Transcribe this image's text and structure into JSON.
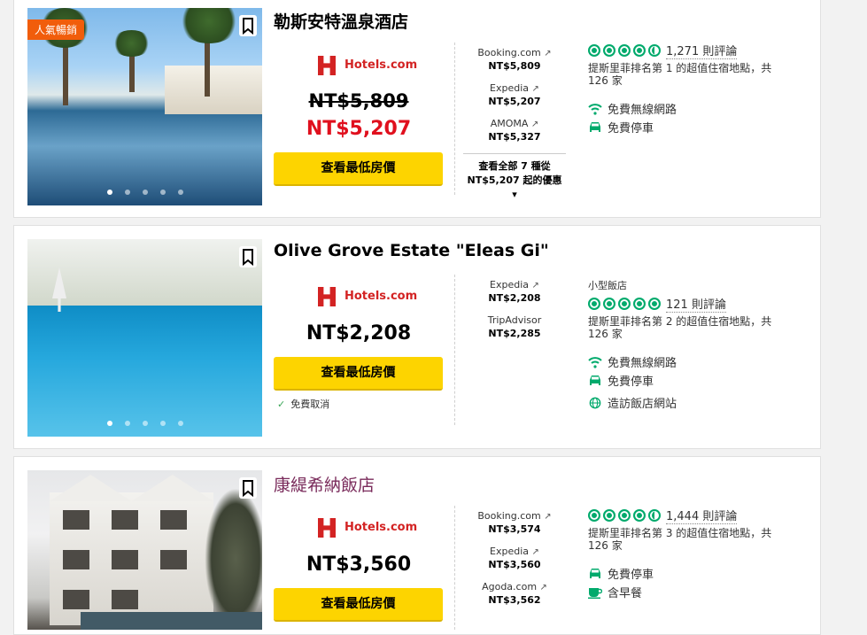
{
  "colors": {
    "accent_green": "#00aa6c",
    "cta_yellow": "#fdd400",
    "sale_red": "#e0101e",
    "badge_orange": "#f15d0b"
  },
  "hotels": [
    {
      "badge": "人氣暢銷",
      "name": "勒斯安特溫泉酒店",
      "provider": "Hotels.com",
      "old_price": "NT$5,809",
      "price": "NT$5,207",
      "cta": "查看最低房價",
      "partners": [
        {
          "name": "Booking.com",
          "price": "NT$5,809"
        },
        {
          "name": "Expedia",
          "price": "NT$5,207"
        },
        {
          "name": "AMOMA",
          "price": "NT$5,327"
        }
      ],
      "more_line1": "查看全部 7 種從",
      "more_line2": "NT$5,207 起的優惠",
      "rating": 4.5,
      "reviews": "1,271 則評論",
      "rank_line1": "提斯里菲排名第 1 的超值住宿地點，共",
      "rank_line2": "126 家",
      "amenities": [
        {
          "icon": "wifi-icon",
          "label": "免費無線網路"
        },
        {
          "icon": "car-icon",
          "label": "免費停車"
        }
      ],
      "photo_index": 1,
      "photo_count": 5
    },
    {
      "name": "Olive Grove Estate \"Eleas Gi\"",
      "provider": "Hotels.com",
      "price": "NT$2,208",
      "cta": "查看最低房價",
      "free_cancel": "免費取消",
      "partners": [
        {
          "name": "Expedia",
          "price": "NT$2,208"
        },
        {
          "name": "TripAdvisor",
          "price": "NT$2,285"
        }
      ],
      "type": "小型飯店",
      "rating": 5,
      "reviews": "121 則評論",
      "rank_line1": "提斯里菲排名第 2 的超值住宿地點，共",
      "rank_line2": "126 家",
      "amenities": [
        {
          "icon": "wifi-icon",
          "label": "免費無線網路"
        },
        {
          "icon": "car-icon",
          "label": "免費停車"
        },
        {
          "icon": "globe-icon",
          "label": "造訪飯店網站"
        }
      ],
      "photo_index": 1,
      "photo_count": 5
    },
    {
      "name": "康緹希納飯店",
      "provider": "Hotels.com",
      "price": "NT$3,560",
      "cta": "查看最低房價",
      "partners": [
        {
          "name": "Booking.com",
          "price": "NT$3,574"
        },
        {
          "name": "Expedia",
          "price": "NT$3,560"
        },
        {
          "name": "Agoda.com",
          "price": "NT$3,562"
        }
      ],
      "rating": 4.5,
      "reviews": "1,444 則評論",
      "rank_line1": "提斯里菲排名第 3 的超值住宿地點，共",
      "rank_line2": "126 家",
      "amenities": [
        {
          "icon": "car-icon",
          "label": "免費停車"
        },
        {
          "icon": "breakfast-icon",
          "label": "含早餐"
        }
      ]
    }
  ]
}
